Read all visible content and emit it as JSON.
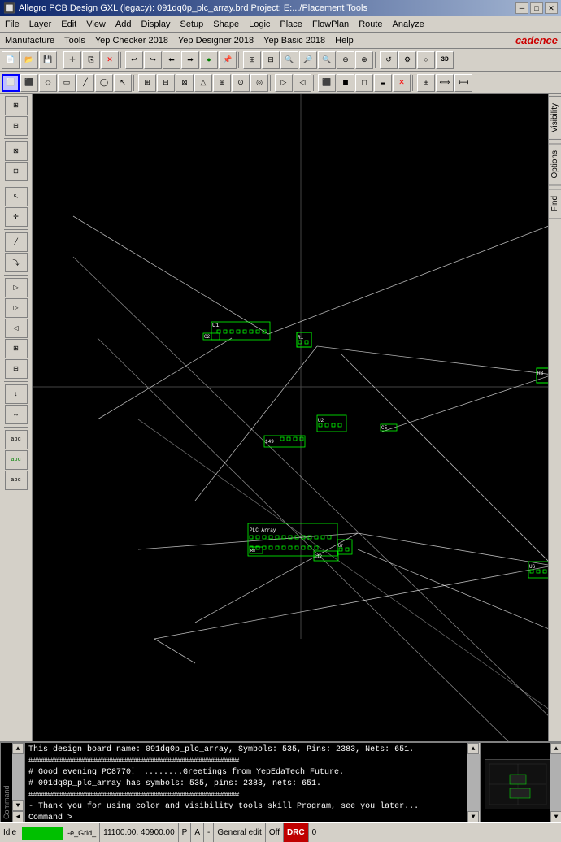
{
  "titlebar": {
    "title": "Allegro PCB Design GXL (legacy): 091dq0p_plc_array.brd  Project: E:.../Placement Tools",
    "minimize": "─",
    "maximize": "□",
    "close": "✕"
  },
  "menubar1": {
    "items": [
      "File",
      "Layer",
      "Edit",
      "View",
      "Add",
      "Display",
      "Setup",
      "Shape",
      "Logic",
      "Place",
      "FlowPlan",
      "Route",
      "Analyze"
    ]
  },
  "menubar2": {
    "items": [
      "Manufacture",
      "Tools",
      "Yep Checker 2018",
      "Yep Designer 2018",
      "Yep Basic 2018",
      "Help"
    ],
    "logo": "cādence"
  },
  "rightTabs": [
    "Visibility",
    "Options",
    "Find"
  ],
  "console": {
    "lines": [
      "This design board name: 091dq0p_plc_array, Symbols: 535, Pins: 2383, Nets: 651.",
      "####################################################################",
      "#  Good evening PC8770！      ........Greetings from YepEdaTech Future.",
      "#  091dq0p_plc_array has symbols: 535, pins: 2383, nets: 651.",
      "####################################################################",
      "- Thank you for using color and visibility tools skill Program, see you later...",
      "Command >"
    ]
  },
  "statusbar": {
    "state": "Idle",
    "coords": "11100.00, 40900.00",
    "p_indicator": "P",
    "a_indicator": "A",
    "dash": "-",
    "mode": "General edit",
    "off": "Off",
    "drc": "DRC",
    "num": "0"
  }
}
